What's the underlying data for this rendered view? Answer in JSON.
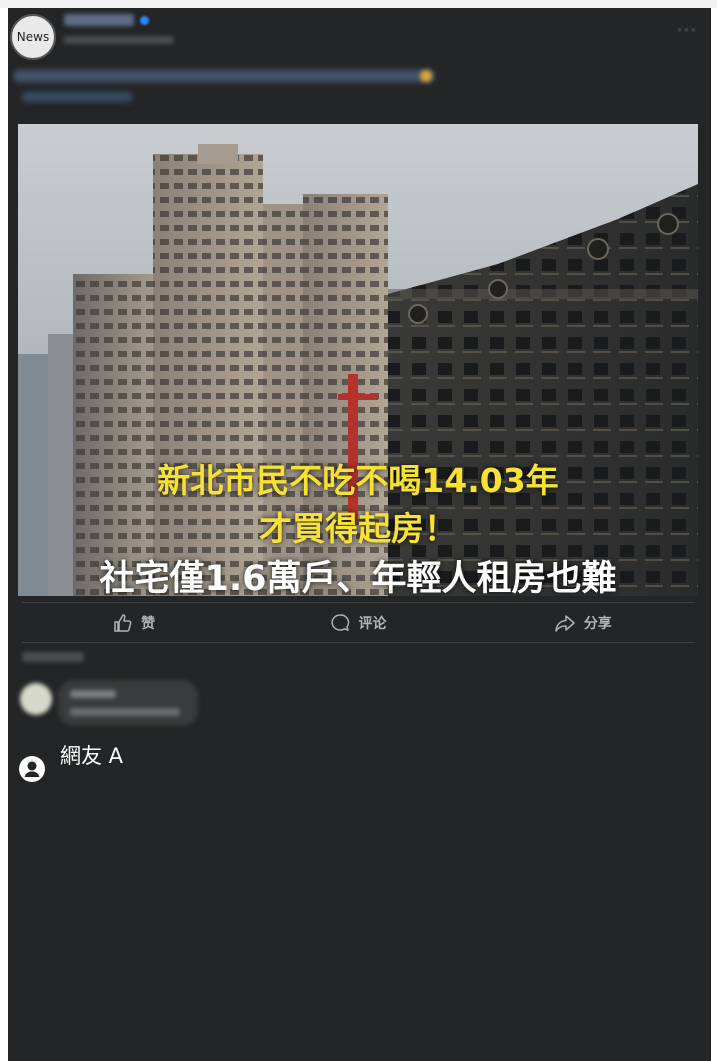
{
  "post": {
    "avatar_text": "News",
    "more_icon": "ellipsis-icon"
  },
  "image": {
    "caption_line1": "新北市民不吃不喝14.03年",
    "caption_line2": "才買得起房！",
    "caption_line3": "社宅僅1.6萬戶、年輕人租房也難",
    "caption_color_highlight": "#f7e234",
    "caption_color_main": "#ffffff"
  },
  "actions": {
    "like_label": "赞",
    "comment_label": "评论",
    "share_label": "分享"
  },
  "commenter": {
    "name": "網友 A"
  },
  "colors": {
    "card_bg": "#242526",
    "text_muted": "#b0b3b8",
    "divider": "#3e4042"
  }
}
